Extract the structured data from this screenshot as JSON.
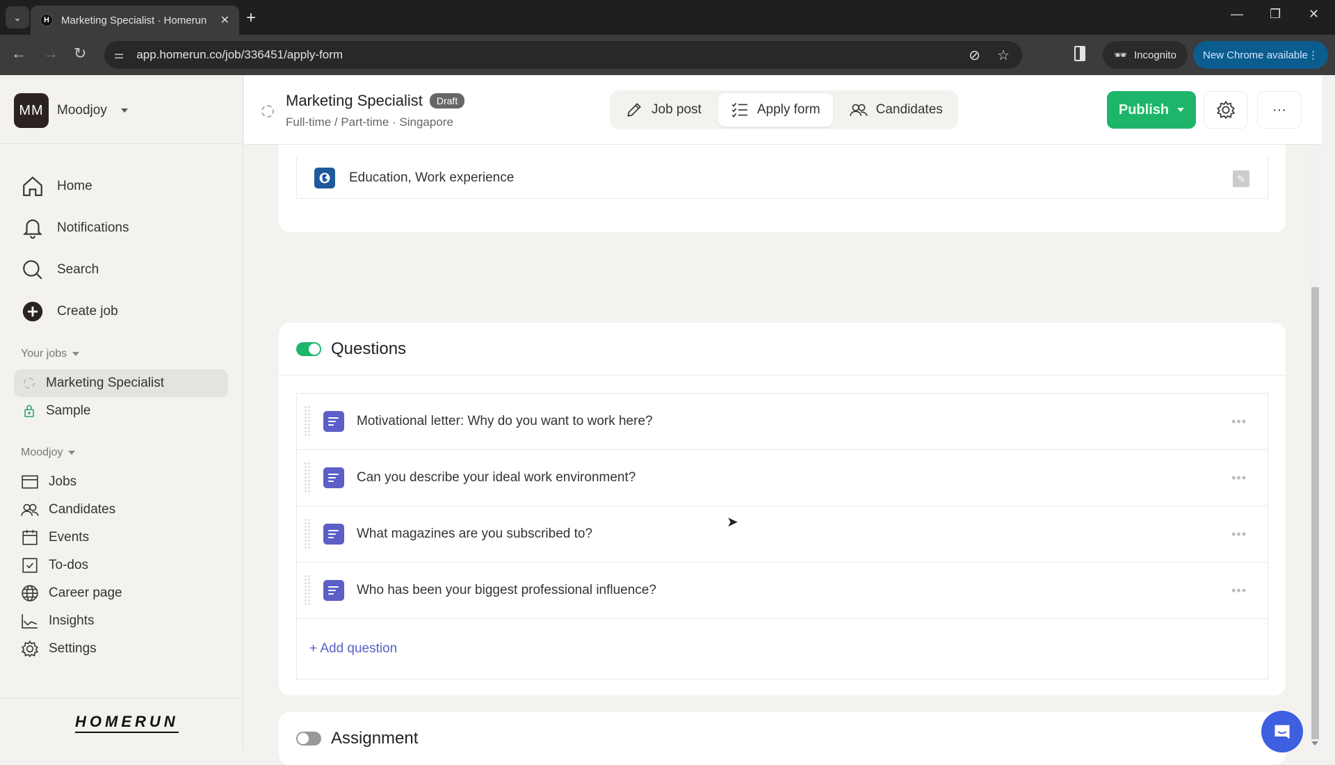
{
  "browser": {
    "tab_title": "Marketing Specialist · Homerun",
    "tab_favicon": "H",
    "url": "app.homerun.co/job/336451/apply-form",
    "incognito_label": "Incognito",
    "update_label": "New Chrome available"
  },
  "sidebar": {
    "workspace": {
      "initials": "MM",
      "name": "Moodjoy"
    },
    "main_nav": [
      {
        "label": "Home",
        "icon": "home-icon"
      },
      {
        "label": "Notifications",
        "icon": "bell-icon"
      },
      {
        "label": "Search",
        "icon": "search-icon"
      },
      {
        "label": "Create job",
        "icon": "plus-circle-icon"
      }
    ],
    "your_jobs_label": "Your jobs",
    "jobs": [
      {
        "label": "Marketing Specialist",
        "icon": "draft-status-icon",
        "active": true
      },
      {
        "label": "Sample",
        "icon": "lock-icon",
        "active": false
      }
    ],
    "org_label": "Moodjoy",
    "org_nav": [
      {
        "label": "Jobs",
        "icon": "jobs-icon"
      },
      {
        "label": "Candidates",
        "icon": "people-icon"
      },
      {
        "label": "Events",
        "icon": "calendar-icon"
      },
      {
        "label": "To-dos",
        "icon": "checkbox-icon"
      },
      {
        "label": "Career page",
        "icon": "globe-icon"
      },
      {
        "label": "Insights",
        "icon": "chart-icon"
      },
      {
        "label": "Settings",
        "icon": "gear-icon"
      }
    ],
    "logo": "HOMERUN"
  },
  "header": {
    "title": "Marketing Specialist",
    "status_badge": "Draft",
    "subtitle": "Full-time / Part-time · Singapore",
    "tabs": [
      {
        "label": "Job post",
        "active": false
      },
      {
        "label": "Apply form",
        "active": true
      },
      {
        "label": "Candidates",
        "active": false
      }
    ],
    "publish_label": "Publish",
    "accent": "#1db56a"
  },
  "profile_section": {
    "row_label": "Education, Work experience"
  },
  "questions_section": {
    "title": "Questions",
    "enabled": true,
    "questions": [
      "Motivational letter: Why do you want to work here?",
      "Can you describe your ideal work environment?",
      "What magazines are you subscribed to?",
      "Who has been your biggest professional influence?"
    ],
    "add_label": "+ Add question"
  },
  "assignment_section": {
    "title": "Assignment",
    "enabled": false
  }
}
